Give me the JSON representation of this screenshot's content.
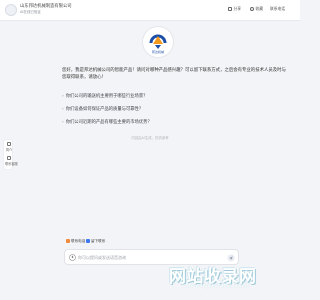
{
  "header": {
    "company_name": "山东邦达机械制造有限公司",
    "company_sub": "AI在线已验证",
    "actions": [
      {
        "label": "分享",
        "icon": "share-icon"
      },
      {
        "label": "收藏",
        "icon": "heart-icon"
      },
      {
        "label": "联系电话",
        "icon": "phone-icon"
      }
    ]
  },
  "side_dock": {
    "items": [
      {
        "label": "简介",
        "icon": "profile-icon"
      },
      {
        "label": "联系客服",
        "icon": "service-icon"
      }
    ]
  },
  "assistant": {
    "avatar_name": "邦达机械",
    "welcome": "您好，我是邦达机械公司的智能产品！请问对哪种产品感兴趣？可以留下联系方式，之后会有专业的技术人员及时与您取得联系，请放心！",
    "questions": [
      "你们公司的输送机主要用于哪些行业场景？",
      "你们设备如何保证产品的质量与可靠性？",
      "你们公司近期的产品有哪些主要的市场优势？"
    ],
    "disclaimer": "内容由AI生成，仅供参考"
  },
  "chips": [
    {
      "label": "联系电话",
      "color": "#f08a3c",
      "icon": "phone-chip-icon"
    },
    {
      "label": "留下联系",
      "color": "#3d7af0",
      "icon": "contact-chip-icon"
    }
  ],
  "input": {
    "placeholder": "你可以提问或发送语音咨询",
    "value": ""
  },
  "watermark": {
    "text": "网站收录网",
    "sub": "www.wangzhanshoulu.com"
  },
  "colors": {
    "accent": "#3d7af0",
    "background": "#f3f4f7"
  }
}
